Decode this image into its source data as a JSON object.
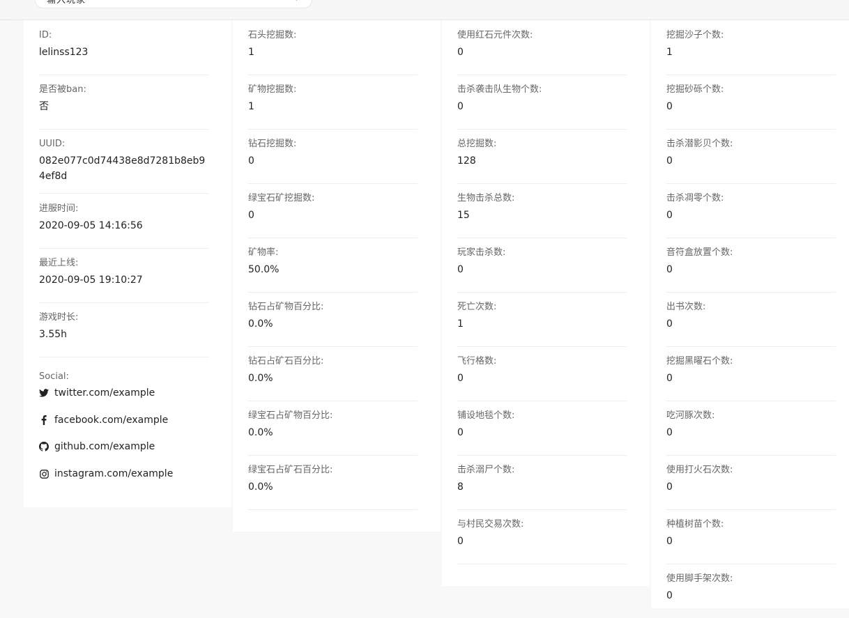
{
  "header": {
    "search_text": "输入玩家"
  },
  "profile": {
    "fields": [
      {
        "label": "ID:",
        "value": "lelinss123"
      },
      {
        "label": "是否被ban:",
        "value": "否"
      },
      {
        "label": "UUID:",
        "value": "082e077c0d74438e8d7281b8eb94ef8d"
      },
      {
        "label": "进服时间:",
        "value": "2020-09-05 14:16:56"
      },
      {
        "label": "最近上线:",
        "value": "2020-09-05 19:10:27"
      },
      {
        "label": "游戏时长:",
        "value": "3.55h"
      }
    ],
    "social": {
      "label": "Social:",
      "links": [
        {
          "icon": "twitter-icon",
          "text": "twitter.com/example"
        },
        {
          "icon": "facebook-icon",
          "text": "facebook.com/example"
        },
        {
          "icon": "github-icon",
          "text": "github.com/example"
        },
        {
          "icon": "instagram-icon",
          "text": "instagram.com/example"
        }
      ]
    }
  },
  "stats_col2": [
    {
      "label": "石头挖掘数:",
      "value": "1"
    },
    {
      "label": "矿物挖掘数:",
      "value": "1"
    },
    {
      "label": "钻石挖掘数:",
      "value": "0"
    },
    {
      "label": "绿宝石矿挖掘数:",
      "value": "0"
    },
    {
      "label": "矿物率:",
      "value": "50.0%"
    },
    {
      "label": "钻石占矿物百分比:",
      "value": "0.0%"
    },
    {
      "label": "钻石占矿石百分比:",
      "value": "0.0%"
    },
    {
      "label": "绿宝石占矿物百分比:",
      "value": "0.0%"
    },
    {
      "label": "绿宝石占矿石百分比:",
      "value": "0.0%"
    }
  ],
  "stats_col3": [
    {
      "label": "使用红石元件次数:",
      "value": "0"
    },
    {
      "label": "击杀袭击队生物个数:",
      "value": "0"
    },
    {
      "label": "总挖掘数:",
      "value": "128"
    },
    {
      "label": "生物击杀总数:",
      "value": "15"
    },
    {
      "label": "玩家击杀数:",
      "value": "0"
    },
    {
      "label": "死亡次数:",
      "value": "1"
    },
    {
      "label": "飞行格数:",
      "value": "0"
    },
    {
      "label": "铺设地毯个数:",
      "value": "0"
    },
    {
      "label": "击杀溺尸个数:",
      "value": "8"
    },
    {
      "label": "与村民交易次数:",
      "value": "0"
    }
  ],
  "stats_col4": [
    {
      "label": "挖掘沙子个数:",
      "value": "1"
    },
    {
      "label": "挖掘砂砾个数:",
      "value": "0"
    },
    {
      "label": "击杀潜影贝个数:",
      "value": "0"
    },
    {
      "label": "击杀凋零个数:",
      "value": "0"
    },
    {
      "label": "音符盒放置个数:",
      "value": "0"
    },
    {
      "label": "出书次数:",
      "value": "0"
    },
    {
      "label": "挖掘黑曜石个数:",
      "value": "0"
    },
    {
      "label": "吃河豚次数:",
      "value": "0"
    },
    {
      "label": "使用打火石次数:",
      "value": "0"
    },
    {
      "label": "种植树苗个数:",
      "value": "0"
    },
    {
      "label": "使用脚手架次数:",
      "value": "0"
    }
  ]
}
